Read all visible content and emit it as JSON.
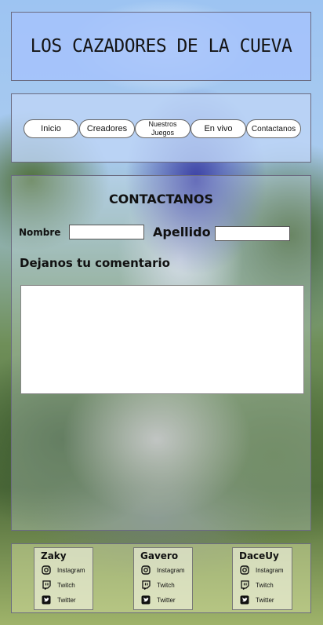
{
  "header": {
    "title": "LOS CAZADORES DE LA CUEVA"
  },
  "nav": {
    "items": [
      {
        "label": "Inicio"
      },
      {
        "label": "Creadores"
      },
      {
        "label_line1": "Nuestros",
        "label_line2": "Juegos"
      },
      {
        "label": "En vivo"
      },
      {
        "label": "Contactanos"
      }
    ]
  },
  "contact": {
    "title": "CONTACTANOS",
    "name_label": "Nombre",
    "name_value": "",
    "surname_label": "Apellido",
    "surname_value": "",
    "comment_label": "Dejanos tu comentario",
    "comment_value": ""
  },
  "footer": {
    "creators": [
      {
        "name": "Zaky",
        "links": [
          "Instagram",
          "Twitch",
          "Twitter"
        ]
      },
      {
        "name": "Gavero",
        "links": [
          "Instagram",
          "Twitch",
          "Twitter"
        ]
      },
      {
        "name": "DaceUy",
        "links": [
          "Instagram",
          "Twitch",
          "Twitter"
        ]
      }
    ],
    "icons": [
      "instagram-icon",
      "twitch-icon",
      "twitter-icon"
    ]
  }
}
